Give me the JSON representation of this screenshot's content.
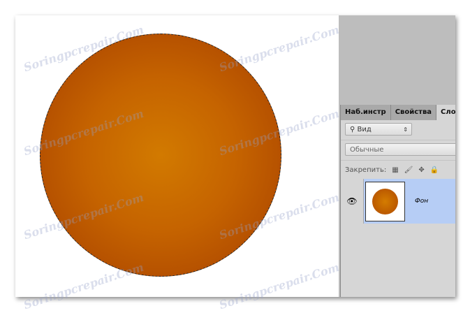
{
  "panel": {
    "tabs": [
      "Наб.инстр",
      "Свойства",
      "Слои"
    ],
    "filter_label": "Вид",
    "blend_mode": "Обычные",
    "lock_label": "Закрепить:"
  },
  "layers": [
    {
      "name": "Фон",
      "visible": true,
      "selected": true
    }
  ],
  "watermark": "Soringpcrepair.Com",
  "colors": {
    "circle_center": "#d27a00",
    "circle_edge": "#a53e00",
    "selection": "#b6cdf5"
  }
}
